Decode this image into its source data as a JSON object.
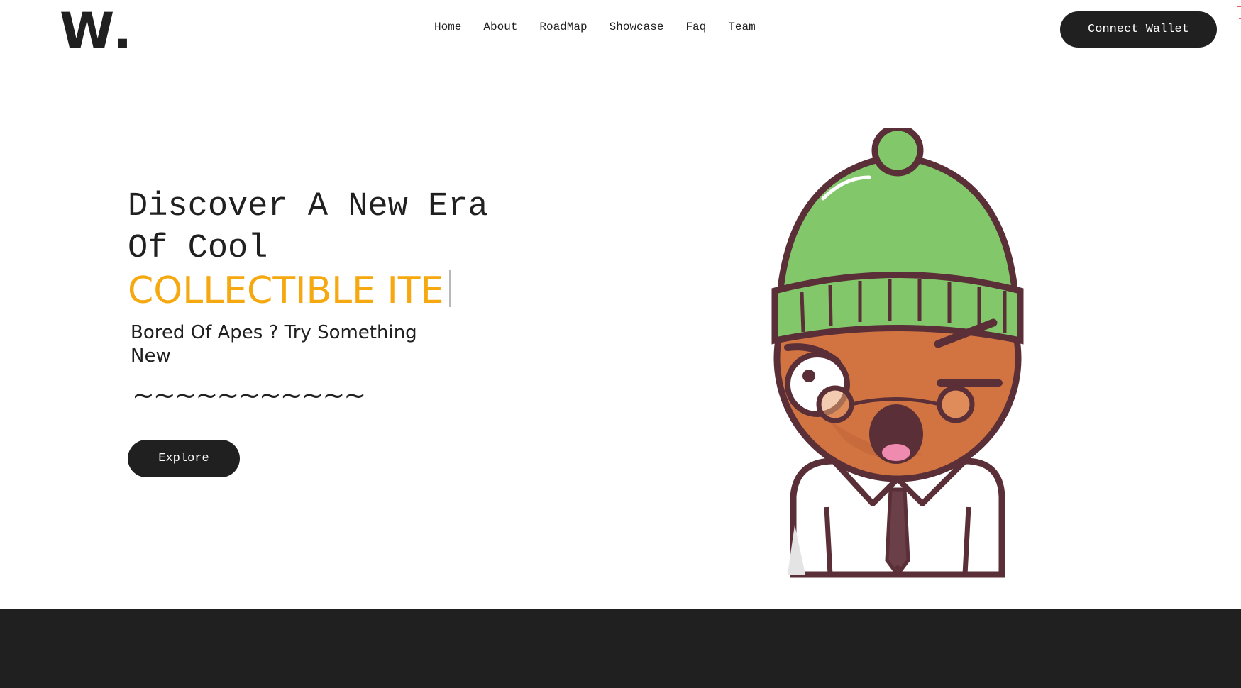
{
  "brand": {
    "logo": "W."
  },
  "nav": {
    "items": [
      {
        "label": "Home"
      },
      {
        "label": "About"
      },
      {
        "label": "RoadMap"
      },
      {
        "label": "Showcase"
      },
      {
        "label": "Faq"
      },
      {
        "label": "Team"
      }
    ],
    "wallet_label": "Connect Wallet"
  },
  "hero": {
    "title_line1": "Discover A New Era",
    "title_line2": "Of Cool",
    "typing_text": "COLLECTIBLE ITE",
    "subtitle": "Bored Of Apes ? Try Something New",
    "tilde": "~~~~~~~~~~~",
    "explore_label": "Explore"
  },
  "colors": {
    "accent": "#f5a80f",
    "dark": "#202020",
    "hat_green": "#82c76a",
    "skin": "#d27441",
    "outline": "#5a2f37"
  },
  "icons": {
    "character": "nft-character-illustration"
  }
}
